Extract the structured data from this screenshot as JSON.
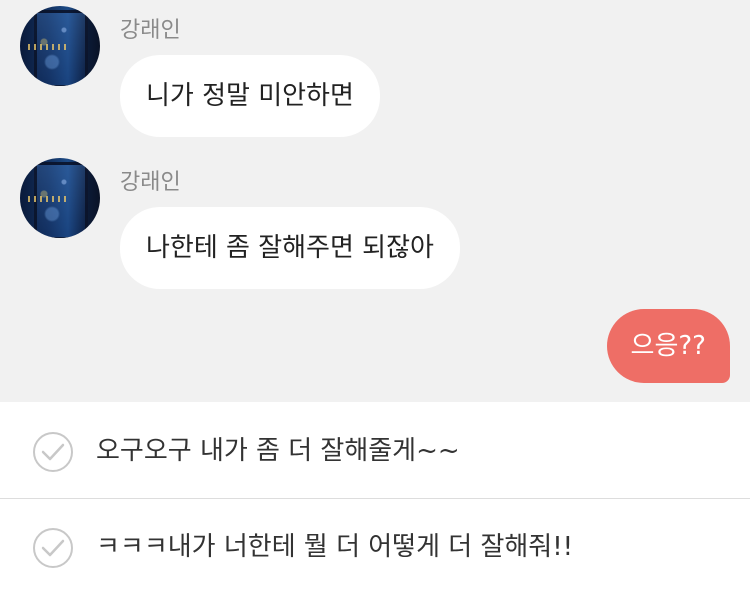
{
  "messages": [
    {
      "sender": "강래인",
      "text": "니가 정말 미안하면"
    },
    {
      "sender": "강래인",
      "text": "나한테 좀 잘해주면 되잖아"
    }
  ],
  "my_message": {
    "text": "으응??"
  },
  "reply_options": [
    {
      "text": "오구오구 내가 좀 더 잘해줄게~~"
    },
    {
      "text": "ㅋㅋㅋ내가 너한테 뭘 더 어떻게 더 잘해줘!!"
    }
  ],
  "colors": {
    "chat_background": "#f1f1f1",
    "my_bubble": "#ee6e66",
    "other_bubble": "#ffffff"
  }
}
